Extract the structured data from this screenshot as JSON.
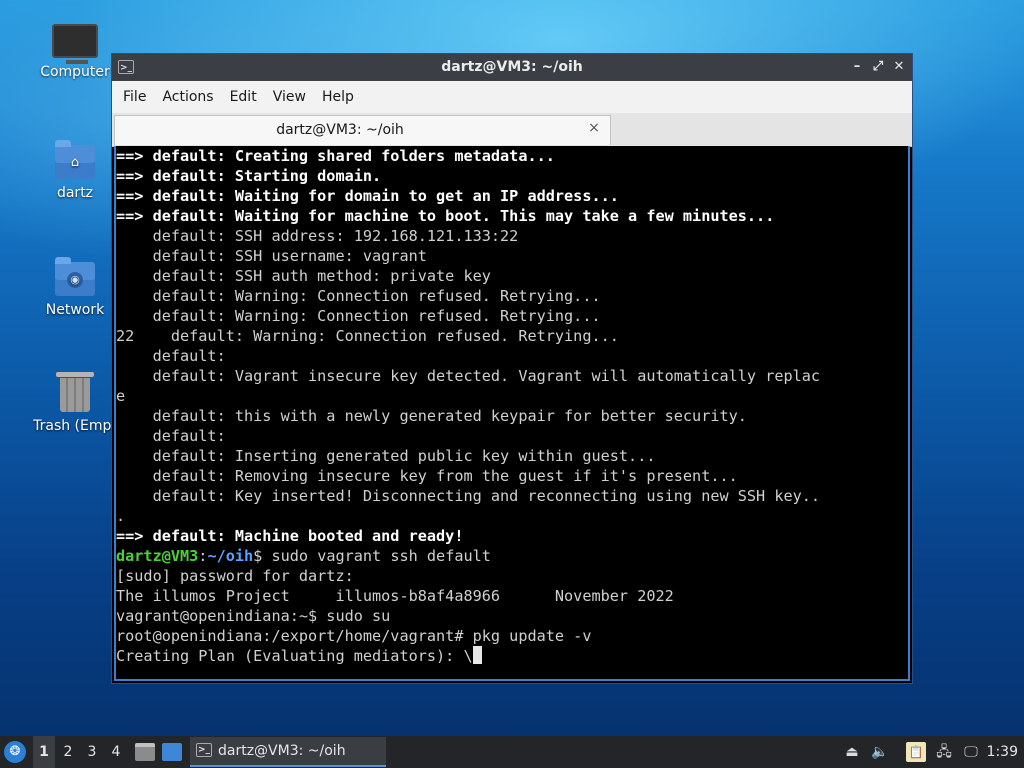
{
  "desktop": {
    "icons": [
      {
        "label": "Computer",
        "icon": "computer-icon"
      },
      {
        "label": "dartz",
        "icon": "home-folder-icon"
      },
      {
        "label": "Network",
        "icon": "network-folder-icon"
      },
      {
        "label": "Trash (Empt",
        "icon": "trash-icon"
      }
    ]
  },
  "window": {
    "title": "dartz@VM3: ~/oih",
    "controls": {
      "minimize": "–",
      "maximize": "⤢",
      "close": "✕"
    },
    "menu": [
      "File",
      "Edit",
      "View",
      "Help",
      "Actions"
    ],
    "menu_order": [
      "File",
      "Actions",
      "Edit",
      "View",
      "Help"
    ],
    "tab": {
      "label": "dartz@VM3: ~/oih",
      "close": "×"
    }
  },
  "terminal": {
    "lines": [
      "==> default: Creating shared folders metadata...",
      "==> default: Starting domain.",
      "==> default: Waiting for domain to get an IP address...",
      "==> default: Waiting for machine to boot. This may take a few minutes...",
      "    default: SSH address: 192.168.121.133:22",
      "    default: SSH username: vagrant",
      "    default: SSH auth method: private key",
      "    default: Warning: Connection refused. Retrying...",
      "    default: Warning: Connection refused. Retrying...",
      "22    default: Warning: Connection refused. Retrying...",
      "    default:",
      "    default: Vagrant insecure key detected. Vagrant will automatically replac",
      "e",
      "    default: this with a newly generated keypair for better security.",
      "    default:",
      "    default: Inserting generated public key within guest...",
      "    default: Removing insecure key from the guest if it's present...",
      "    default: Key inserted! Disconnecting and reconnecting using new SSH key..",
      ".",
      "==> default: Machine booted and ready!"
    ],
    "prompt": {
      "user": "dartz@VM3",
      "sep": ":",
      "path": "~/oih",
      "symbol": "$",
      "command": " sudo vagrant ssh default"
    },
    "after_prompt": [
      "[sudo] password for dartz:",
      "The illumos Project     illumos-b8af4a8966      November 2022",
      "vagrant@openindiana:~$ sudo su",
      "root@openindiana:/export/home/vagrant# pkg update -v",
      "Creating Plan (Evaluating mediators): \\"
    ]
  },
  "taskbar": {
    "start_icon": "start-menu-icon",
    "workspaces": [
      "1",
      "2",
      "3",
      "4"
    ],
    "active_workspace": "1",
    "task_label": "dartz@VM3: ~/oih",
    "clock": "1:39"
  }
}
